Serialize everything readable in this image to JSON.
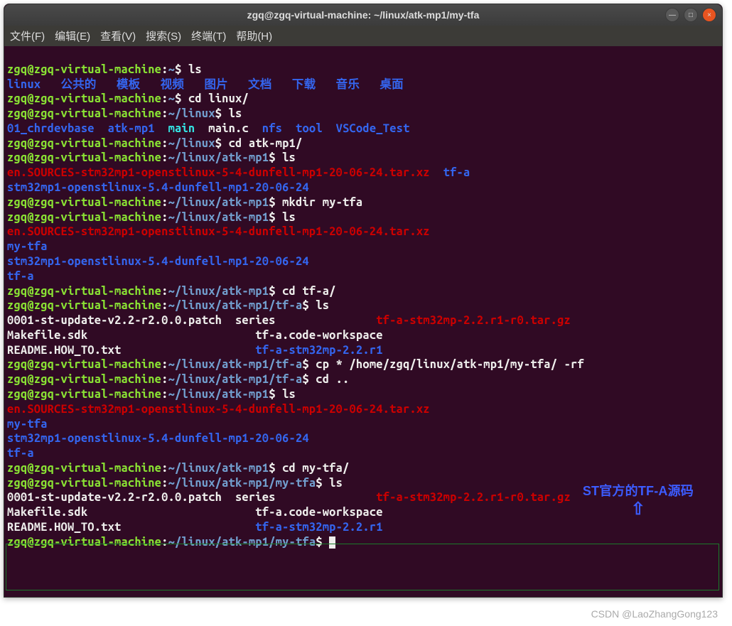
{
  "window": {
    "title": "zgq@zgq-virtual-machine: ~/linux/atk-mp1/my-tfa"
  },
  "menu": {
    "file": "文件(F)",
    "edit": "编辑(E)",
    "view": "查看(V)",
    "search": "搜索(S)",
    "terminal": "终端(T)",
    "help": "帮助(H)"
  },
  "p": {
    "user_host": "zgq@zgq-virtual-machine",
    "sep": ":",
    "home": "~",
    "linux": "~/linux",
    "atkmp1": "~/linux/atk-mp1",
    "tfa": "~/linux/atk-mp1/tf-a",
    "mytfa": "~/linux/atk-mp1/my-tfa",
    "dollar": "$"
  },
  "cmd": {
    "ls": "ls",
    "cd_linux": "cd linux/",
    "cd_atkmp1": "cd atk-mp1/",
    "mkdir_mytfa": "mkdir my-tfa",
    "cd_tfa": "cd tf-a/",
    "cp": "cp * /home/zgq/linux/atk-mp1/my-tfa/ -rf",
    "cd_up": "cd ..",
    "cd_mytfa": "cd my-tfa/"
  },
  "home_ls": {
    "linux": "linux",
    "public": "公共的",
    "templates": "模板",
    "videos": "视频",
    "pictures": "图片",
    "documents": "文档",
    "downloads": "下载",
    "music": "音乐",
    "desktop": "桌面"
  },
  "linux_ls": {
    "chrdev": "01_chrdevbase",
    "atkmp1": "atk-mp1",
    "main_dir": "main",
    "mainc": "main.c",
    "nfs": "nfs",
    "tool": "tool",
    "vscode": "VSCode_Test"
  },
  "atk": {
    "sources": "en.SOURCES-stm32mp1-openstlinux-5-4-dunfell-mp1-20-06-24.tar.xz",
    "tfa": "tf-a",
    "openstlinux": "stm32mp1-openstlinux-5.4-dunfell-mp1-20-06-24",
    "mytfa": "my-tfa"
  },
  "tfa_ls": {
    "patch": "0001-st-update-v2.2-r2.0.0.patch",
    "makefile": "Makefile.sdk",
    "readme": "README.HOW_TO.txt",
    "series": "series",
    "codews": "tf-a.code-workspace",
    "stm32mp": "tf-a-stm32mp-2.2.r1",
    "targz": "tf-a-stm32mp-2.2.r1-r0.tar.gz"
  },
  "annotation": {
    "text": "ST官方的TF-A源码",
    "arrow": "⇧"
  },
  "watermark": "CSDN @LaoZhangGong123"
}
